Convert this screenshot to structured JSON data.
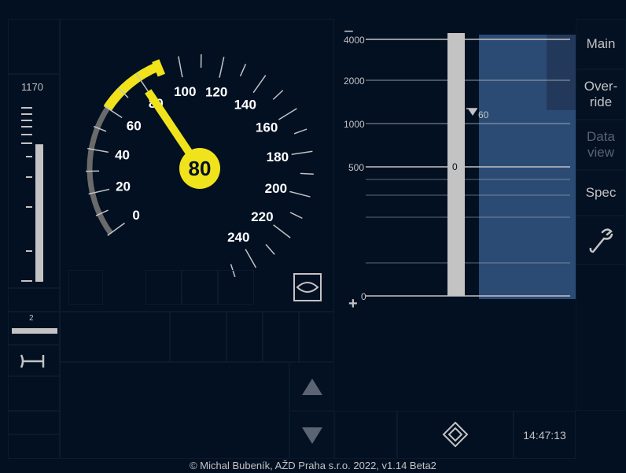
{
  "distance_panel": {
    "target_distance": "1170",
    "fill_fraction": 0.75,
    "brake_percentage": "2"
  },
  "speedometer": {
    "current_speed": "80",
    "current_speed_value": 80,
    "hook_speed_value": 90,
    "max_speed": 250,
    "labels": [
      "0",
      "20",
      "40",
      "60",
      "80",
      "100",
      "120",
      "140",
      "160",
      "180",
      "200",
      "220",
      "240"
    ],
    "colors": {
      "needle": "#f0e31b",
      "arc_grey": "#6a6a6a",
      "arc_yellow": "#f0e31b"
    }
  },
  "planning": {
    "distance_labels": [
      "4000",
      "2000",
      "1000",
      "500",
      "0"
    ],
    "bar_label": "0",
    "speed_indicator": "60",
    "zoom_out": "−",
    "zoom_in": "+"
  },
  "menu": {
    "main": "Main",
    "override": "Over-\nride",
    "data_view": "Data\nview",
    "spec": "Spec",
    "settings_icon": "wrench-icon"
  },
  "status": {
    "clock": "14:47:13",
    "level_icon": "level-crossing-icon",
    "mode_icon": "buffer-stop-icon",
    "eye_icon": "eye-icon"
  },
  "footer": "© Michal Bubeník, AŽD Praha s.r.o. 2022, v1.14 Beta2"
}
